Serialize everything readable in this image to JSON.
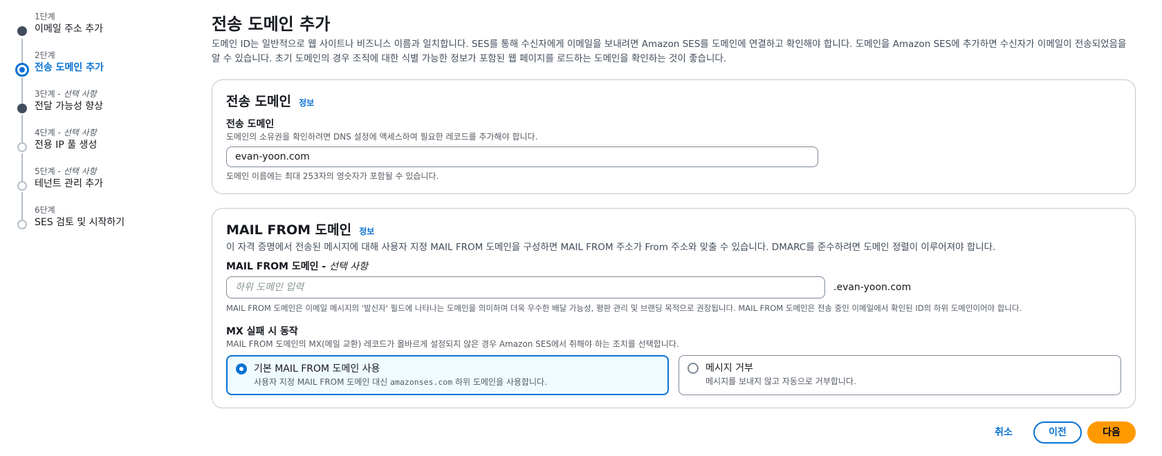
{
  "stepper": [
    {
      "num": "1단계",
      "optional": "",
      "label": "이메일 주소 추가",
      "state": "done"
    },
    {
      "num": "2단계",
      "optional": "",
      "label": "전송 도메인 추가",
      "state": "current"
    },
    {
      "num": "3단계 - ",
      "optional": "선택 사항",
      "label": "전달 가능성 향상",
      "state": "done"
    },
    {
      "num": "4단계 - ",
      "optional": "선택 사항",
      "label": "전용 IP 풀 생성",
      "state": "pending"
    },
    {
      "num": "5단계 - ",
      "optional": "선택 사항",
      "label": "테넌트 관리 추가",
      "state": "pending"
    },
    {
      "num": "6단계",
      "optional": "",
      "label": "SES 검토 및 시작하기",
      "state": "pending"
    }
  ],
  "page": {
    "title": "전송 도메인 추가",
    "intro": "도메인 ID는 일반적으로 웹 사이트나 비즈니스 이름과 일치합니다. SES를 통해 수신자에게 이메일을 보내려면 Amazon SES를 도메인에 연결하고 확인해야 합니다. 도메인을 Amazon SES에 추가하면 수신자가 이메일이 전송되었음을 알 수 있습니다. 초기 도메인의 경우 조직에 대한 식별 가능한 정보가 포함된 웹 페이지를 로드하는 도메인을 확인하는 것이 좋습니다."
  },
  "sending_domain": {
    "heading": "전송 도메인",
    "info": "정보",
    "field_label": "전송 도메인",
    "field_desc": "도메인의 소유권을 확인하려면 DNS 설정에 액세스하여 필요한 레코드를 추가해야 합니다.",
    "value": "evan-yoon.com",
    "hint": "도메인 이름에는 최대 253자의 영숫자가 포함될 수 있습니다."
  },
  "mail_from": {
    "heading": "MAIL FROM 도메인",
    "info": "정보",
    "description": "이 자격 증명에서 전송된 메시지에 대해 사용자 지정 MAIL FROM 도메인을 구성하면 MAIL FROM 주소가 From 주소와 맞출 수 있습니다. DMARC를 준수하려면 도메인 정렬이 이루어져야 합니다.",
    "field_label": "MAIL FROM 도메인",
    "field_optional": "선택 사항",
    "placeholder": "하위 도메인 입력",
    "suffix": ".evan-yoon.com",
    "hint": "MAIL FROM 도메인은 이메일 메시지의 '발신자' 필드에 나타나는 도메인을 의미하며 더욱 우수한 배달 가능성, 평판 관리 및 브랜딩 목적으로 권장됩니다. MAIL FROM 도메인은 전송 중인 이메일에서 확인된 ID의 하위 도메인이어야 합니다.",
    "mx_label": "MX 실패 시 동작",
    "mx_desc": "MAIL FROM 도메인의 MX(메일 교환) 레코드가 올바르게 설정되지 않은 경우 Amazon SES에서 취해야 하는 조치를 선택합니다.",
    "options": [
      {
        "title": "기본 MAIL FROM 도메인 사용",
        "desc_pre": "사용자 지정 MAIL FROM 도메인 대신 ",
        "desc_code": "amazonses.com",
        "desc_post": " 하위 도메인을 사용합니다.",
        "selected": true
      },
      {
        "title": "메시지 거부",
        "desc_pre": "메시지를 보내지 않고 자동으로 거부합니다.",
        "desc_code": "",
        "desc_post": "",
        "selected": false
      }
    ]
  },
  "actions": {
    "cancel": "취소",
    "previous": "이전",
    "next": "다음"
  },
  "colors": {
    "accent": "#0972d3",
    "primary_button": "#ff9900",
    "selected_tile_bg": "#f0fbff"
  }
}
